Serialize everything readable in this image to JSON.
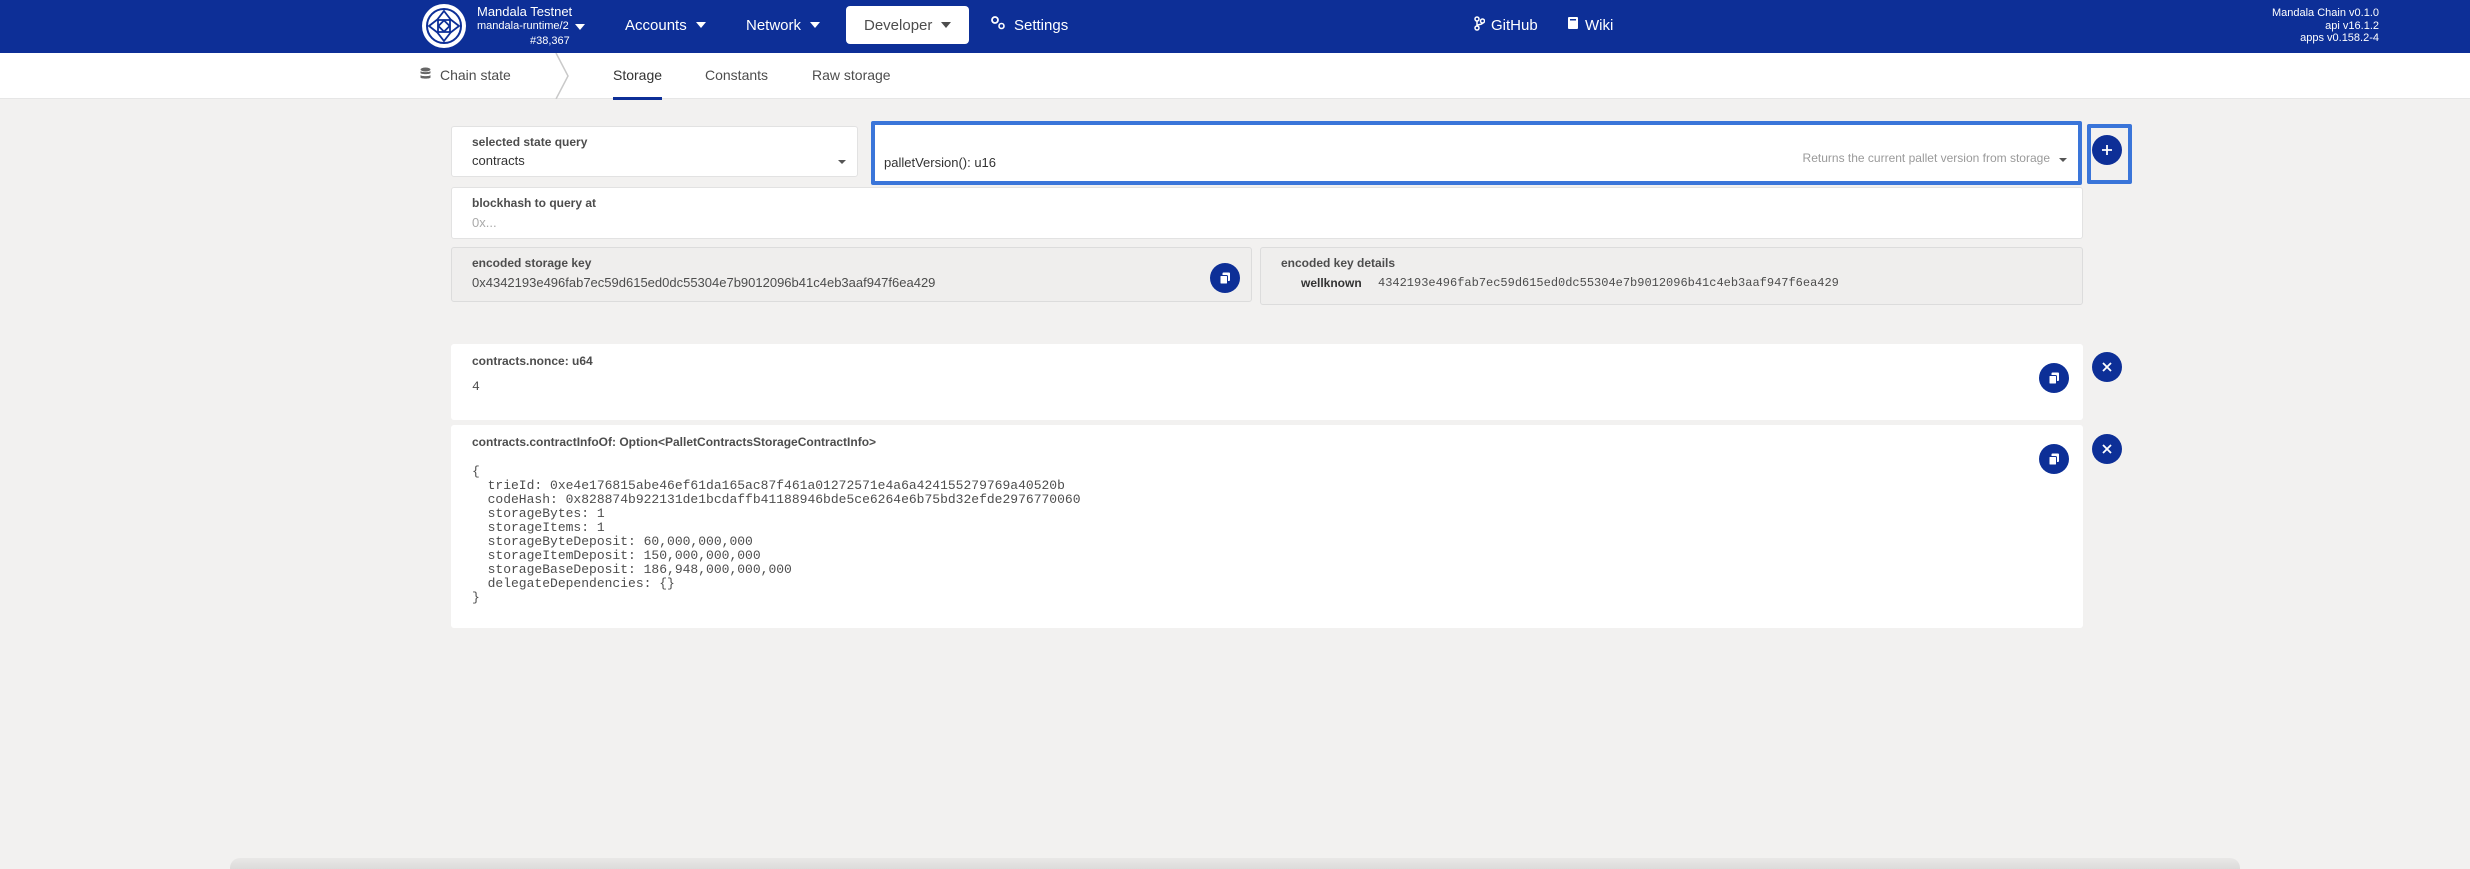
{
  "topbar": {
    "chain_name": "Mandala Testnet",
    "runtime": "mandala-runtime/2",
    "block": "#38,367",
    "nav": {
      "accounts": "Accounts",
      "network": "Network",
      "developer": "Developer",
      "settings": "Settings",
      "github": "GitHub",
      "wiki": "Wiki"
    },
    "versions": {
      "chain": "Mandala Chain v0.1.0",
      "api": "api v16.1.2",
      "apps": "apps v0.158.2-4"
    },
    "colors": {
      "bar": "#0d2f97"
    }
  },
  "subnav": {
    "section": "Chain state",
    "tabs": [
      "Storage",
      "Constants",
      "Raw storage"
    ],
    "active_tab": "Storage"
  },
  "query": {
    "selected_label": "selected state query",
    "selected_value": "contracts",
    "method_value": "palletVersion(): u16",
    "method_description": "Returns the current pallet version from storage",
    "blockhash_label": "blockhash to query at",
    "blockhash_placeholder": "0x...",
    "encoded_key_label": "encoded storage key",
    "encoded_key_value": "0x4342193e496fab7ec59d615ed0dc55304e7b9012096b41c4eb3aaf947f6ea429",
    "key_details_label": "encoded key details",
    "wellknown_label": "wellknown",
    "wellknown_value": "4342193e496fab7ec59d615ed0dc55304e7b9012096b41c4eb3aaf947f6ea429"
  },
  "results": [
    {
      "label": "contracts.nonce: u64",
      "value": "4"
    },
    {
      "label": "contracts.contractInfoOf: Option<PalletContractsStorageContractInfo>",
      "value": "{\n  trieId: 0xe4e176815abe46ef61da165ac87f461a01272571e4a6a424155279769a40520b\n  codeHash: 0x828874b922131de1bcdaffb41188946bde5ce6264e6b75bd32efde2976770060\n  storageBytes: 1\n  storageItems: 1\n  storageByteDeposit: 60,000,000,000\n  storageItemDeposit: 150,000,000,000\n  storageBaseDeposit: 186,948,000,000,000\n  delegateDependencies: {}\n}"
    }
  ]
}
